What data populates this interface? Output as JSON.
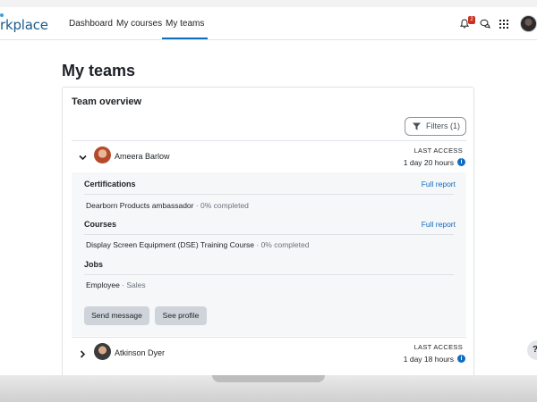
{
  "app": {
    "logo_text": "rkplace"
  },
  "nav": {
    "links": [
      "Dashboard",
      "My courses",
      "My teams"
    ],
    "active": "My teams",
    "notification_count": "2",
    "icons": [
      "bell-icon",
      "chat-icon",
      "apps-grid-icon",
      "user-avatar"
    ]
  },
  "page": {
    "title": "My teams"
  },
  "overview": {
    "title": "Team overview",
    "filters_label": "Filters (1)",
    "members": [
      {
        "name": "Ameera Barlow",
        "last_access_label": "LAST ACCESS",
        "last_access": "1 day 20 hours",
        "expanded": true
      },
      {
        "name": "Atkinson Dyer",
        "last_access_label": "LAST ACCESS",
        "last_access": "1 day 18 hours",
        "expanded": false
      }
    ],
    "detail": {
      "certifications_title": "Certifications",
      "certifications_link": "Full report",
      "certification_name": "Dearborn Products ambassador",
      "certification_status": " · 0% completed",
      "courses_title": "Courses",
      "courses_link": "Full report",
      "course_name": "Display Screen Equipment (DSE) Training Course",
      "course_status": " · 0% completed",
      "jobs_title": "Jobs",
      "job_name": "Employee",
      "job_org": " · Sales",
      "send_message_label": "Send message",
      "see_profile_label": "See profile"
    }
  },
  "help": {
    "label": "?"
  },
  "colors": {
    "accent": "#0f6cbf",
    "badge": "#ca3120"
  }
}
